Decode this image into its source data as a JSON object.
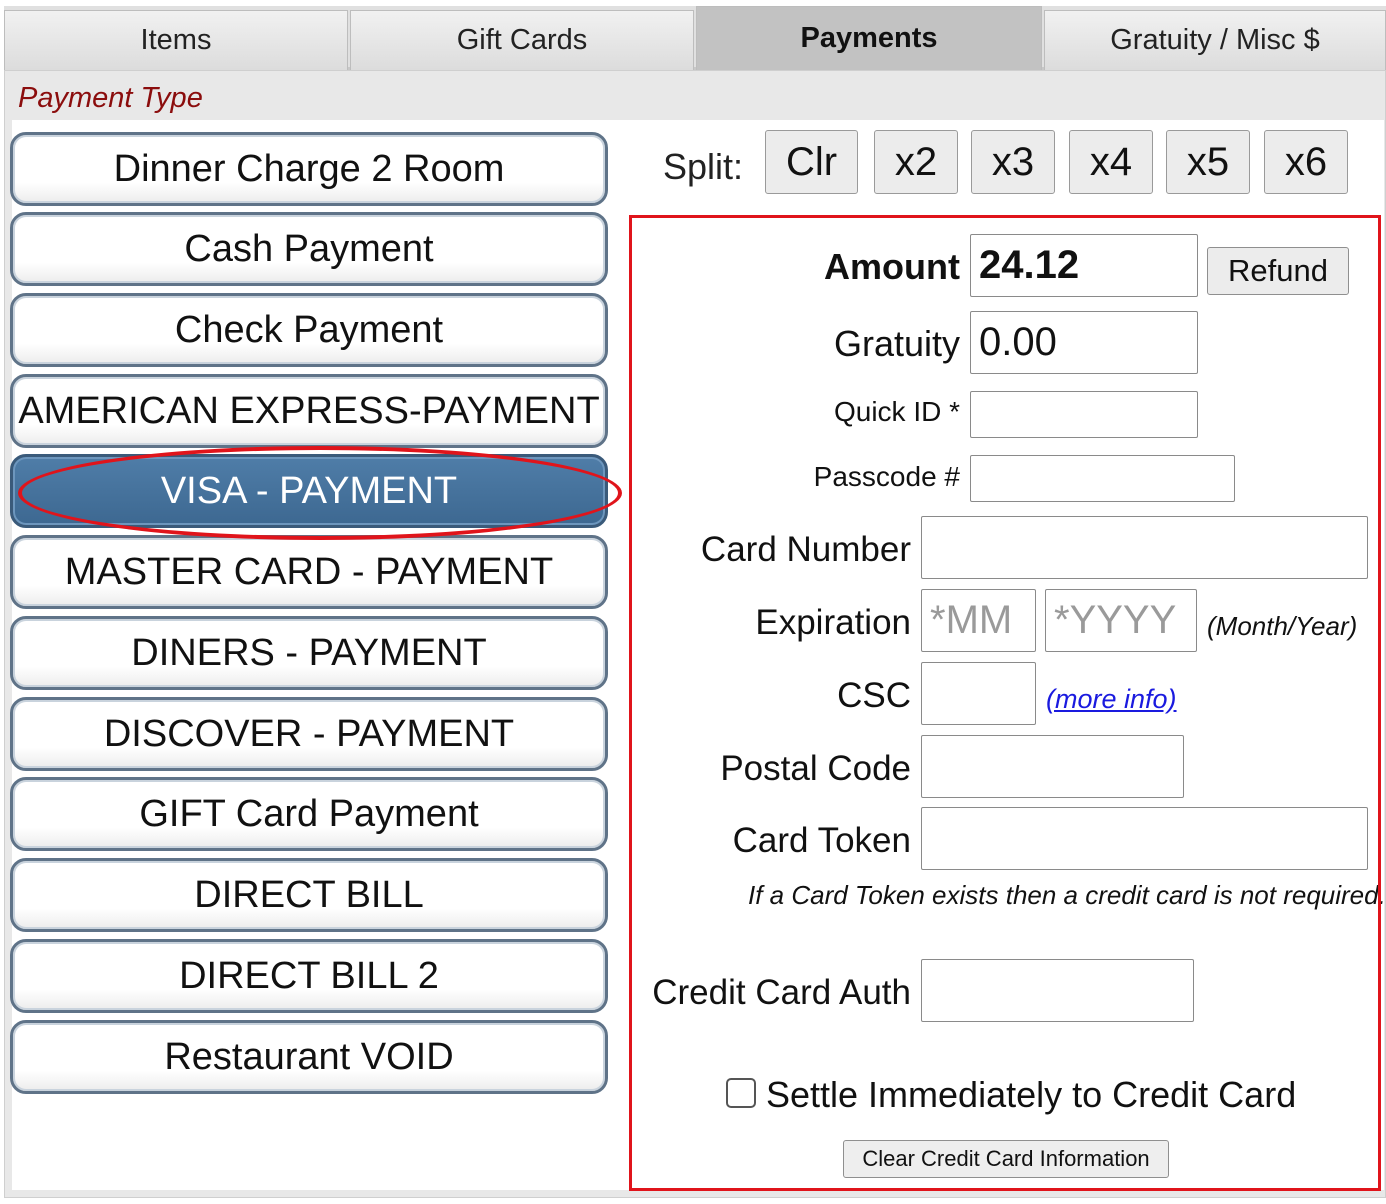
{
  "tabs": [
    {
      "label": "Items"
    },
    {
      "label": "Gift Cards"
    },
    {
      "label": "Payments"
    },
    {
      "label": "Gratuity / Misc $"
    }
  ],
  "payment_type_label": "Payment Type",
  "payment_methods": [
    {
      "label": "Dinner Charge 2 Room"
    },
    {
      "label": "Cash Payment"
    },
    {
      "label": "Check Payment"
    },
    {
      "label": "AMERICAN EXPRESS-PAYMENT"
    },
    {
      "label": "VISA - PAYMENT",
      "selected": true
    },
    {
      "label": "MASTER CARD - PAYMENT"
    },
    {
      "label": "DINERS - PAYMENT"
    },
    {
      "label": "DISCOVER - PAYMENT"
    },
    {
      "label": "GIFT Card Payment"
    },
    {
      "label": "DIRECT BILL"
    },
    {
      "label": "DIRECT BILL 2"
    },
    {
      "label": "Restaurant VOID"
    }
  ],
  "split": {
    "label": "Split:",
    "buttons": [
      "Clr",
      "x2",
      "x3",
      "x4",
      "x5",
      "x6"
    ]
  },
  "form": {
    "amount_label": "Amount",
    "amount_value": "24.12",
    "refund_label": "Refund",
    "gratuity_label": "Gratuity",
    "gratuity_value": "0.00",
    "quick_id_label": "Quick ID *",
    "quick_id_value": "",
    "passcode_label": "Passcode #",
    "passcode_value": "",
    "card_number_label": "Card Number",
    "card_number_value": "",
    "expiration_label": "Expiration",
    "exp_month_placeholder": "*MM",
    "exp_year_placeholder": "*YYYY",
    "exp_hint": "(Month/Year)",
    "csc_label": "CSC",
    "csc_value": "",
    "csc_more_info": "(more info)",
    "postal_label": "Postal Code",
    "postal_value": "",
    "token_label": "Card Token",
    "token_value": "",
    "token_hint": "If a Card Token exists then a credit card is not required.",
    "auth_label": "Credit Card Auth",
    "auth_value": "",
    "settle_label": "Settle Immediately to Credit Card",
    "settle_checked": false,
    "clear_label": "Clear Credit Card Information"
  },
  "colors": {
    "selected_button": "#3d6891",
    "highlight_red": "#e0141b",
    "payment_type_label": "#8b0d0d",
    "link_blue": "#1a1adf"
  }
}
